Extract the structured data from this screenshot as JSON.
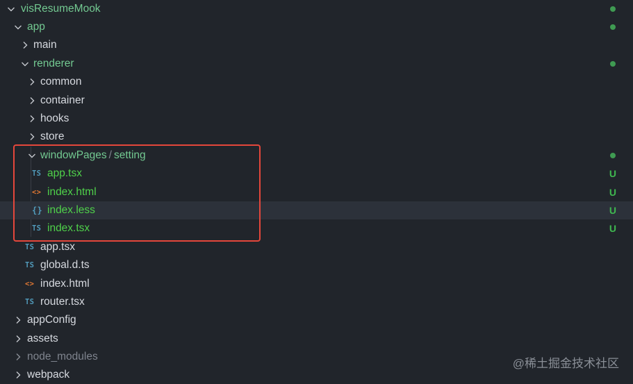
{
  "explorer": {
    "items": [
      {
        "label": "visResumeMook",
        "kind": "folder-open",
        "status": "dot"
      },
      {
        "label": "app",
        "kind": "folder-open",
        "status": "dot"
      },
      {
        "label": "main",
        "kind": "folder-closed"
      },
      {
        "label": "renderer",
        "kind": "folder-open",
        "status": "dot"
      },
      {
        "label": "common",
        "kind": "folder-closed"
      },
      {
        "label": "container",
        "kind": "folder-closed"
      },
      {
        "label": "hooks",
        "kind": "folder-closed"
      },
      {
        "label": "store",
        "kind": "folder-closed"
      },
      {
        "label": "windowPages",
        "label_child": "setting",
        "separator": "/",
        "kind": "folder-open",
        "status": "dot"
      },
      {
        "label": "app.tsx",
        "icon": "TS",
        "status": "U"
      },
      {
        "label": "index.html",
        "icon": "<>",
        "status": "U"
      },
      {
        "label": "index.less",
        "icon": "{}",
        "status": "U"
      },
      {
        "label": "index.tsx",
        "icon": "TS",
        "status": "U"
      },
      {
        "label": "app.tsx",
        "icon": "TS"
      },
      {
        "label": "global.d.ts",
        "icon": "TS"
      },
      {
        "label": "index.html",
        "icon": "<>"
      },
      {
        "label": "router.tsx",
        "icon": "TS"
      },
      {
        "label": "appConfig",
        "kind": "folder-closed"
      },
      {
        "label": "assets",
        "kind": "folder-closed"
      },
      {
        "label": "node_modules",
        "kind": "folder-closed"
      },
      {
        "label": "webpack",
        "kind": "folder-closed"
      }
    ]
  },
  "watermark": "@稀土掘金技术社区",
  "colors": {
    "background": "#21252b",
    "modified_green": "#73c991",
    "untracked_green": "#3fb950",
    "highlight_border": "#e5473b",
    "ts_icon": "#519aba",
    "html_icon": "#e37933"
  }
}
